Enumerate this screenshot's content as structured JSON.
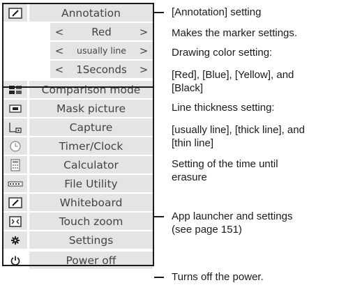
{
  "menu": {
    "annotation": {
      "label": "Annotation"
    },
    "color": {
      "prev": "<",
      "value": "Red",
      "next": ">"
    },
    "thickness": {
      "prev": "<",
      "value": "usually line",
      "next": ">"
    },
    "time": {
      "prev": "<",
      "value": "1Seconds",
      "next": ">"
    },
    "items": [
      {
        "label": "Comparison mode",
        "icon": "comparison-icon"
      },
      {
        "label": "Mask picture",
        "icon": "mask-icon"
      },
      {
        "label": "Capture",
        "icon": "capture-icon"
      },
      {
        "label": "Timer/Clock",
        "icon": "clock-icon"
      },
      {
        "label": "Calculator",
        "icon": "calculator-icon"
      },
      {
        "label": "File Utility",
        "icon": "file-utility-icon"
      },
      {
        "label": "Whiteboard",
        "icon": "whiteboard-icon"
      },
      {
        "label": "Touch zoom",
        "icon": "touch-zoom-icon"
      },
      {
        "label": "Settings",
        "icon": "gear-icon"
      }
    ],
    "power": {
      "label": "Power off",
      "icon": "power-icon"
    }
  },
  "notes": {
    "annotation_setting": "[Annotation] setting",
    "marker_settings": "Makes the marker settings.",
    "drawing_color_title": "Drawing color setting:",
    "drawing_color_values_1": "[Red], [Blue], [Yellow], and",
    "drawing_color_values_2": "[Black]",
    "thickness_title": "Line thickness setting:",
    "thickness_values_1": "[usually line], [thick line], and",
    "thickness_values_2": "[thin line]",
    "erase_time_1": "Setting of the time until",
    "erase_time_2": "erasure",
    "app_launcher_1": "App launcher and settings",
    "app_launcher_2": "(see page 151)",
    "power_off": "Turns off the power."
  }
}
